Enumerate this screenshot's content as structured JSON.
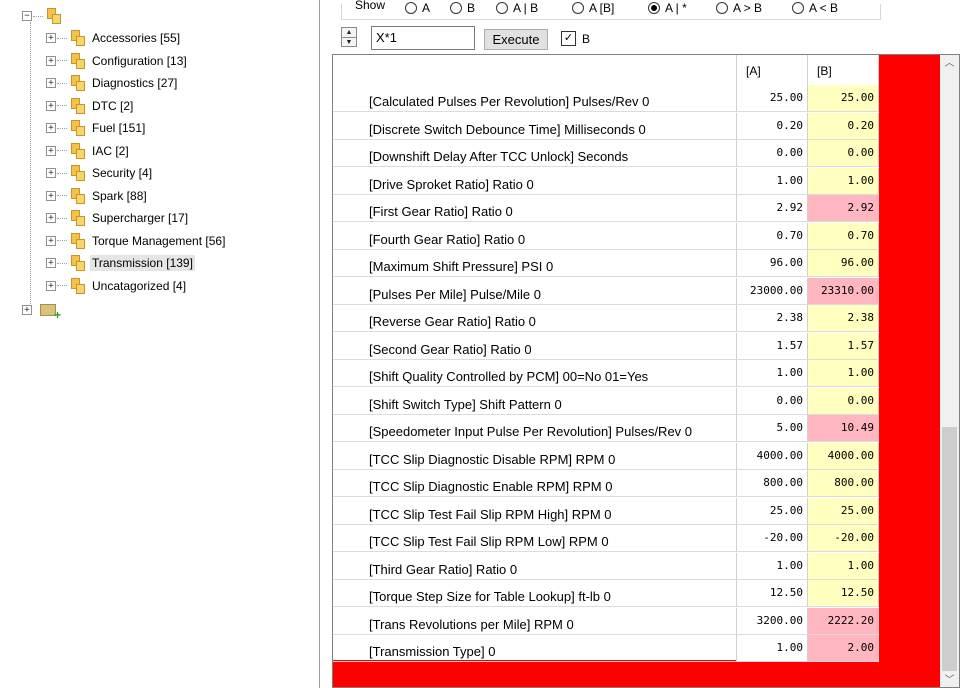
{
  "tree": {
    "items": [
      {
        "label": "Accessories [55]",
        "selected": false
      },
      {
        "label": "Configuration [13]",
        "selected": false
      },
      {
        "label": "Diagnostics [27]",
        "selected": false
      },
      {
        "label": "DTC [2]",
        "selected": false
      },
      {
        "label": "Fuel [151]",
        "selected": false
      },
      {
        "label": "IAC [2]",
        "selected": false
      },
      {
        "label": "Security [4]",
        "selected": false
      },
      {
        "label": "Spark [88]",
        "selected": false
      },
      {
        "label": "Supercharger [17]",
        "selected": false
      },
      {
        "label": "Torque Management [56]",
        "selected": false
      },
      {
        "label": "Transmission [139]",
        "selected": true
      },
      {
        "label": "Uncatagorized [4]",
        "selected": false
      }
    ]
  },
  "toolbar": {
    "show_label": "Show",
    "radios": [
      {
        "label": "A",
        "checked": false
      },
      {
        "label": "B",
        "checked": false
      },
      {
        "label": "A | B",
        "checked": false
      },
      {
        "label": "A [B]",
        "checked": false
      },
      {
        "label": "A | *",
        "checked": true
      },
      {
        "label": "A > B",
        "checked": false
      },
      {
        "label": "A < B",
        "checked": false
      }
    ],
    "expression_value": "X*1",
    "execute_label": "Execute",
    "b_checkbox_label": "B",
    "b_checkbox_checked": true
  },
  "grid": {
    "col_a": "[A]",
    "col_b": "[B]",
    "rows": [
      {
        "name": "[Calculated Pulses Per Revolution] Pulses/Rev 0",
        "a": "25.00",
        "b": "25.00",
        "differs": false
      },
      {
        "name": "[Discrete Switch Debounce Time] Milliseconds 0",
        "a": "0.20",
        "b": "0.20",
        "differs": false
      },
      {
        "name": "[Downshift Delay After TCC Unlock] Seconds",
        "a": "0.00",
        "b": "0.00",
        "differs": false
      },
      {
        "name": "[Drive Sproket Ratio] Ratio 0",
        "a": "1.00",
        "b": "1.00",
        "differs": false
      },
      {
        "name": "[First Gear Ratio] Ratio 0",
        "a": "2.92",
        "b": "2.92",
        "differs": true
      },
      {
        "name": "[Fourth Gear Ratio] Ratio 0",
        "a": "0.70",
        "b": "0.70",
        "differs": false
      },
      {
        "name": "[Maximum Shift Pressure] PSI 0",
        "a": "96.00",
        "b": "96.00",
        "differs": false
      },
      {
        "name": "[Pulses Per Mile] Pulse/Mile 0",
        "a": "23000.00",
        "b": "23310.00",
        "differs": true
      },
      {
        "name": "[Reverse Gear Ratio] Ratio 0",
        "a": "2.38",
        "b": "2.38",
        "differs": false
      },
      {
        "name": "[Second Gear Ratio] Ratio 0",
        "a": "1.57",
        "b": "1.57",
        "differs": false
      },
      {
        "name": "[Shift Quality Controlled by PCM] 00=No 01=Yes",
        "a": "1.00",
        "b": "1.00",
        "differs": false
      },
      {
        "name": "[Shift Switch Type] Shift Pattern 0",
        "a": "0.00",
        "b": "0.00",
        "differs": false
      },
      {
        "name": "[Speedometer Input Pulse Per Revolution] Pulses/Rev 0",
        "a": "5.00",
        "b": "10.49",
        "differs": true
      },
      {
        "name": "[TCC Slip Diagnostic Disable RPM] RPM 0",
        "a": "4000.00",
        "b": "4000.00",
        "differs": false
      },
      {
        "name": "[TCC Slip Diagnostic Enable RPM] RPM 0",
        "a": "800.00",
        "b": "800.00",
        "differs": false
      },
      {
        "name": "[TCC Slip Test Fail Slip RPM High] RPM 0",
        "a": "25.00",
        "b": "25.00",
        "differs": false
      },
      {
        "name": "[TCC Slip Test Fail Slip RPM Low] RPM 0",
        "a": "-20.00",
        "b": "-20.00",
        "differs": false
      },
      {
        "name": "[Third Gear Ratio] Ratio 0",
        "a": "1.00",
        "b": "1.00",
        "differs": false
      },
      {
        "name": "[Torque Step Size for Table Lookup] ft-lb 0",
        "a": "12.50",
        "b": "12.50",
        "differs": false
      },
      {
        "name": "[Trans Revolutions per Mile] RPM 0",
        "a": "3200.00",
        "b": "2222.20",
        "differs": true
      },
      {
        "name": "[Transmission Type]  0",
        "a": "1.00",
        "b": "2.00",
        "differs": true
      }
    ]
  },
  "colors": {
    "same_bg": "#ffffc0",
    "diff_bg": "#ffb6c1",
    "empty_area": "#ff0000"
  },
  "icons": {
    "expand": "plus-box-icon",
    "collapse": "minus-box-icon",
    "folder": "folder-icon",
    "add_folder": "add-folder-icon",
    "scroll_up": "chevron-up-icon",
    "scroll_down": "chevron-down-icon"
  }
}
